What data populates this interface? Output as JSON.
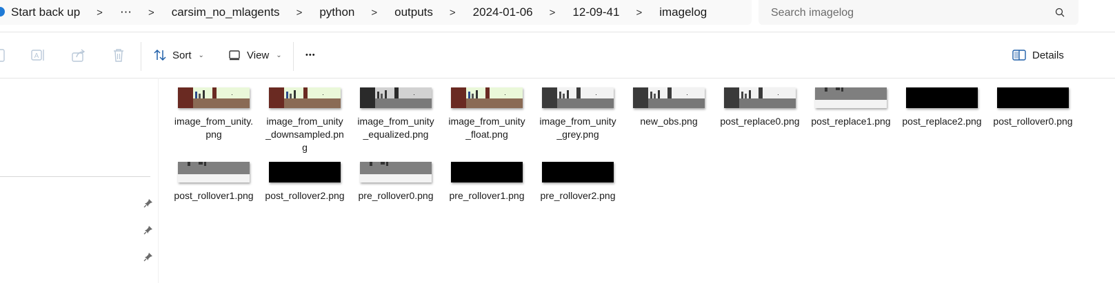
{
  "breadcrumb": {
    "items": [
      "Start back up",
      "⋯",
      "carsim_no_mlagents",
      "python",
      "outputs",
      "2024-01-06",
      "12-09-41",
      "imagelog"
    ],
    "separator": ">"
  },
  "search": {
    "placeholder": "Search imagelog",
    "value": ""
  },
  "toolbar": {
    "sort_label": "Sort",
    "view_label": "View",
    "more_label": "•••",
    "details_label": "Details"
  },
  "files": [
    {
      "name": "image_from_unity.png",
      "thumb": "color"
    },
    {
      "name": "image_from_unity_downsampled.png",
      "thumb": "color"
    },
    {
      "name": "image_from_unity_equalized.png",
      "thumb": "equalized"
    },
    {
      "name": "image_from_unity_float.png",
      "thumb": "color"
    },
    {
      "name": "image_from_unity_grey.png",
      "thumb": "grey"
    },
    {
      "name": "new_obs.png",
      "thumb": "grey"
    },
    {
      "name": "post_replace0.png",
      "thumb": "grey"
    },
    {
      "name": "post_replace1.png",
      "thumb": "road"
    },
    {
      "name": "post_replace2.png",
      "thumb": "black"
    },
    {
      "name": "post_rollover0.png",
      "thumb": "black"
    },
    {
      "name": "post_rollover1.png",
      "thumb": "road"
    },
    {
      "name": "post_rollover2.png",
      "thumb": "black"
    },
    {
      "name": "pre_rollover0.png",
      "thumb": "road"
    },
    {
      "name": "pre_rollover1.png",
      "thumb": "black"
    },
    {
      "name": "pre_rollover2.png",
      "thumb": "black"
    }
  ],
  "colors": {
    "accent": "#1f7ad6",
    "nav_divider": "#d6d6d6"
  }
}
